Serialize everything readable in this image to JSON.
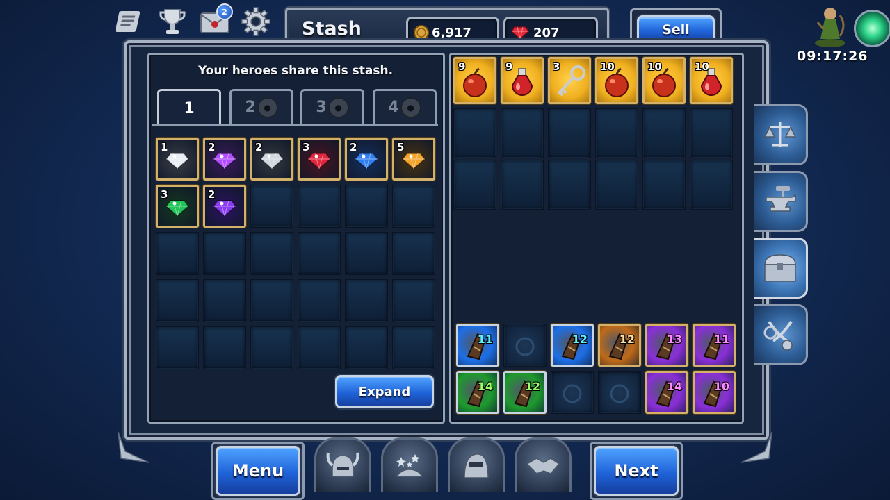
{
  "header": {
    "title": "Stash",
    "gold": "6,917",
    "gems": "207",
    "sell_label": "Sell",
    "mail_badge": "2",
    "clock": "09:17:26"
  },
  "stash": {
    "info": "Your heroes share this stash.",
    "tabs": [
      "1",
      "2",
      "3",
      "4"
    ],
    "expand_label": "Expand",
    "gems": [
      {
        "qty": "1",
        "color": "#e8eef5",
        "bg": "#3a3f46"
      },
      {
        "qty": "2",
        "color": "#b14cff",
        "bg": "#3b1a5c"
      },
      {
        "qty": "2",
        "color": "#cfd8df",
        "bg": "#343a3e"
      },
      {
        "qty": "3",
        "color": "#e0253d",
        "bg": "#4a1420"
      },
      {
        "qty": "2",
        "color": "#2f7ef0",
        "bg": "#15305e"
      },
      {
        "qty": "5",
        "color": "#f2a32a",
        "bg": "#4a3410"
      },
      {
        "qty": "3",
        "color": "#22c45a",
        "bg": "#14381e"
      },
      {
        "qty": "2",
        "color": "#8a3cf0",
        "bg": "#2a1360"
      }
    ]
  },
  "inventory": {
    "consumables": [
      {
        "qty": "9",
        "kind": "apple"
      },
      {
        "qty": "9",
        "kind": "potion"
      },
      {
        "qty": "3",
        "kind": "key"
      },
      {
        "qty": "10",
        "kind": "apple"
      },
      {
        "qty": "10",
        "kind": "apple"
      },
      {
        "qty": "10",
        "kind": "potion"
      }
    ],
    "equipment_row1": [
      {
        "level": "11",
        "rarity": "blue"
      },
      {
        "level": "",
        "rarity": "empty"
      },
      {
        "level": "12",
        "rarity": "blue"
      },
      {
        "level": "12",
        "rarity": "orange"
      },
      {
        "level": "13",
        "rarity": "purple"
      },
      {
        "level": "11",
        "rarity": "purple"
      }
    ],
    "equipment_row2": [
      {
        "level": "14",
        "rarity": "green"
      },
      {
        "level": "12",
        "rarity": "green"
      },
      {
        "level": "",
        "rarity": "empty"
      },
      {
        "level": "",
        "rarity": "empty"
      },
      {
        "level": "14",
        "rarity": "purple"
      },
      {
        "level": "10",
        "rarity": "purple"
      }
    ]
  },
  "footer": {
    "menu_label": "Menu",
    "next_label": "Next"
  },
  "colors": {
    "gold_bg": "#f0b020",
    "blue_item": "#1d6fe8",
    "green_item": "#1e9a2e",
    "purple_item": "#8a2fd8",
    "orange_item": "#c06a18"
  }
}
